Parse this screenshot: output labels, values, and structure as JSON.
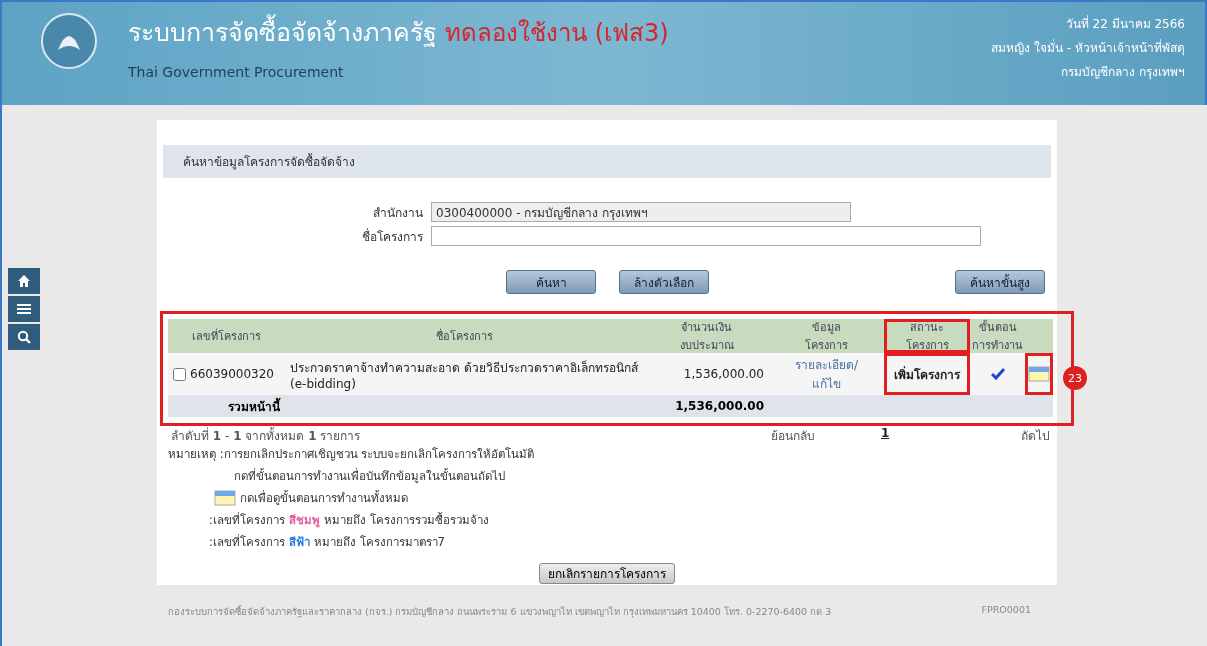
{
  "header": {
    "title": "ระบบการจัดซื้อจัดจ้างภาครัฐ",
    "badge": "ทดลองใช้งาน (เฟส3)",
    "subtitle": "Thai Government Procurement",
    "date": "วันที่ 22 มีนาคม 2566",
    "user": "สมหญิง ใจมั่น - หัวหน้าเจ้าหน้าที่พัสดุ",
    "org": "กรมบัญชีกลาง กรุงเทพฯ"
  },
  "section_title": "ค้นหาข้อมูลโครงการจัดซื้อจัดจ้าง",
  "fields": [
    {
      "label": "สำนักงาน",
      "value": "0300400000 - กรมบัญชีกลาง กรุงเทพฯ",
      "disabled": true
    },
    {
      "label": "ชื่อโครงการ",
      "disabled": false
    }
  ],
  "buttons": [
    "ค้นหา",
    "ล้างตัวเลือก"
  ],
  "advanced_button": "ค้นหาขั้นสูง",
  "table": {
    "columns": [
      {
        "label": "เลขที่โครงการ",
        "highlighted": false
      },
      {
        "label": "ชื่อโครงการ",
        "highlighted": false
      },
      {
        "label": "จำนวนเงิน\nงบประมาณ",
        "highlighted": false
      },
      {
        "label": "ข้อมูล\nโครงการ",
        "highlighted": false
      },
      {
        "label": "สถานะ\nโครงการ",
        "highlighted": true
      },
      {
        "label": "ขั้นตอน\nการทำงาน",
        "highlighted": false
      }
    ],
    "rows": [
      {
        "checked": false,
        "number": "66039000320",
        "name": "ประกวดราคาจ้างทำความสะอาด ด้วยวิธีประกวดราคาอิเล็กทรอนิกส์ (e-bidding)",
        "amount": "1,536,000.00",
        "link": "รายละเอียด/\nแก้ไข",
        "status": "เพิ่มโครงการ",
        "status_highlighted": true,
        "steps_highlighted": true
      }
    ],
    "total_label": "รวมหน้านี้",
    "total": "1,536,000.00",
    "highlighted": true
  },
  "callout": "23",
  "pagination": {
    "summary": "ลำดับที่ **1** - **1** จากทั้งหมด **1** รายการ",
    "back": "ย้อนกลับ",
    "page": "1",
    "next": "ถัดไป"
  },
  "notes": {
    "label": "หมายเหตุ :",
    "lines": [
      "การยกเลิกประกาศเชิญชวน ระบบจะยกเลิกโครงการให้อัตโนมัติ"
    ],
    "check_hint": "กดที่ขั้นตอนการทำงานเพื่อบันทึกข้อมูลในขั้นตอนถัดไป",
    "steps_hint": "กดเพื่อดูขั้นตอนการทำงานทั้งหมด",
    "legend": [
      {
        "prefix": ":เลขที่โครงการ",
        "word": "สีชมพู",
        "suffix": "หมายถึง โครงการรวมซื้อรวมจ้าง",
        "color": "#e05aa0"
      },
      {
        "prefix": ":เลขที่โครงการ",
        "word": "สีฟ้า",
        "suffix": "หมายถึง โครงการมาตรา7",
        "color": "#2a7de0"
      }
    ]
  },
  "cancel_button": "ยกเลิกรายการโครงการ",
  "footer": {
    "address": "กองระบบการจัดซื้อจัดจ้างภาครัฐและราคากลาง (กจร.) กรมบัญชีกลาง ถนนพระราม 6 แขวงพญาไท เขตพญาไท กรุงเทพมหานคร 10400 โทร. 0-2270-6400 กด 3",
    "code": "FPRO0001"
  }
}
